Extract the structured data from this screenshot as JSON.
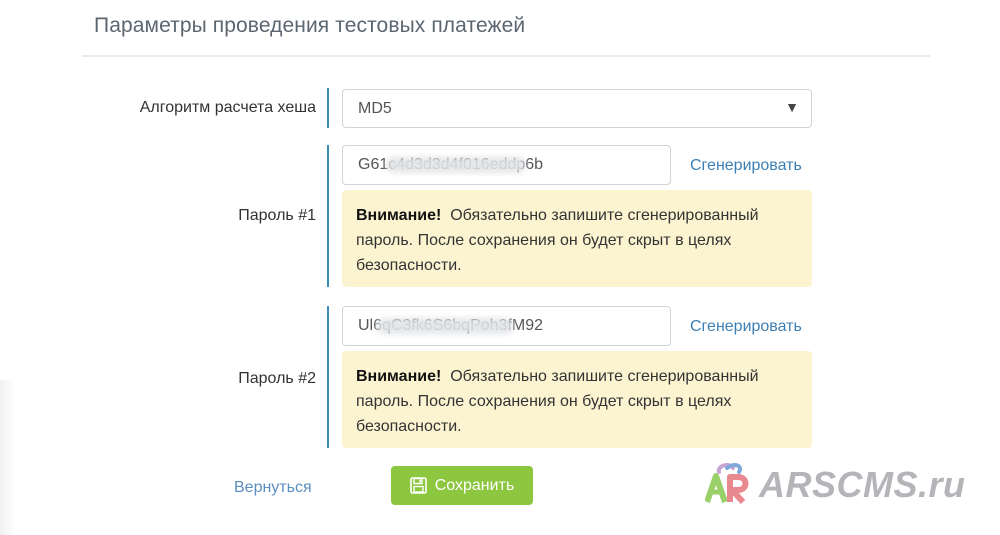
{
  "section": {
    "title": "Параметры проведения тестовых платежей"
  },
  "hash_algorithm": {
    "label": "Алгоритм расчета хеша",
    "selected": "MD5"
  },
  "password1": {
    "label": "Пароль #1",
    "value": "G61c4d3d3d4f016eddp6b",
    "generate_label": "Сгенерировать",
    "warning_title": "Внимание!",
    "warning_text": "Обязательно запишите сгенерированный пароль. После сохранения он будет скрыт в целях безопасности."
  },
  "password2": {
    "label": "Пароль #2",
    "value": "Ul6qC3fk6S6bqPoh3fM92",
    "generate_label": "Сгенерировать",
    "warning_title": "Внимание!",
    "warning_text": "Обязательно запишите сгенерированный пароль. После сохранения он будет скрыт в целях безопасности."
  },
  "actions": {
    "back_label": "Вернуться",
    "save_label": "Сохранить"
  },
  "watermark": {
    "text": "ARSCMS.ru"
  },
  "colors": {
    "accent_bar": "#3c8dbc",
    "link": "#3c7fb5",
    "save_button": "#8dc63f",
    "warning_bg": "#fcf4d1"
  }
}
